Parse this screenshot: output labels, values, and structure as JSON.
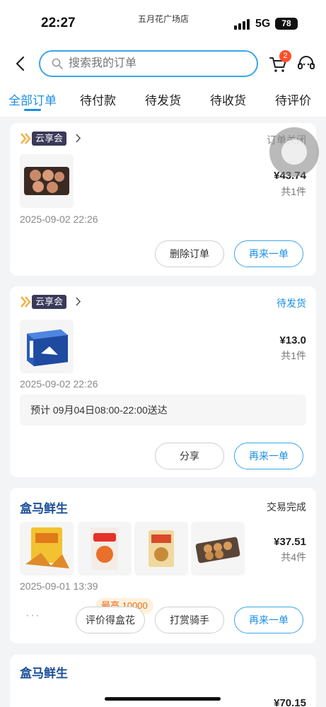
{
  "status_bar": {
    "time": "22:27",
    "store_name": "五月花广场店",
    "network": "5G",
    "battery": "78"
  },
  "header": {
    "search_placeholder": "搜索我的订单",
    "cart_count": "2",
    "tabs": [
      {
        "label": "全部订单",
        "active": true
      },
      {
        "label": "待付款",
        "active": false
      },
      {
        "label": "待发货",
        "active": false
      },
      {
        "label": "待收货",
        "active": false
      },
      {
        "label": "待评价",
        "active": false
      }
    ]
  },
  "orders": [
    {
      "brand": "云享会",
      "status": "订单关闭",
      "price": "¥43.74",
      "qty": "共1件",
      "date": "2025-09-02 22:26",
      "buttons": [
        "删除订单",
        "再来一单"
      ]
    },
    {
      "brand": "云享会",
      "status": "待发货",
      "price": "¥13.0",
      "qty": "共1件",
      "date": "2025-09-02 22:26",
      "delivery_note": "预计 09月04日08:00-22:00送达",
      "buttons": [
        "分享",
        "再来一单"
      ]
    },
    {
      "brand": "盒马鲜生",
      "status": "交易完成",
      "price": "¥37.51",
      "qty": "共4件",
      "date": "2025-09-01 13:39",
      "more": "···",
      "promo": "最高 10000",
      "buttons": [
        "评价得盒花",
        "打赏骑手",
        "再来一单"
      ]
    },
    {
      "brand": "盒马鲜生",
      "price": "¥70.15"
    }
  ],
  "colors": {
    "accent": "#1a8fe3",
    "brand_dark": "#39395a",
    "badge": "#ff4f2b"
  }
}
